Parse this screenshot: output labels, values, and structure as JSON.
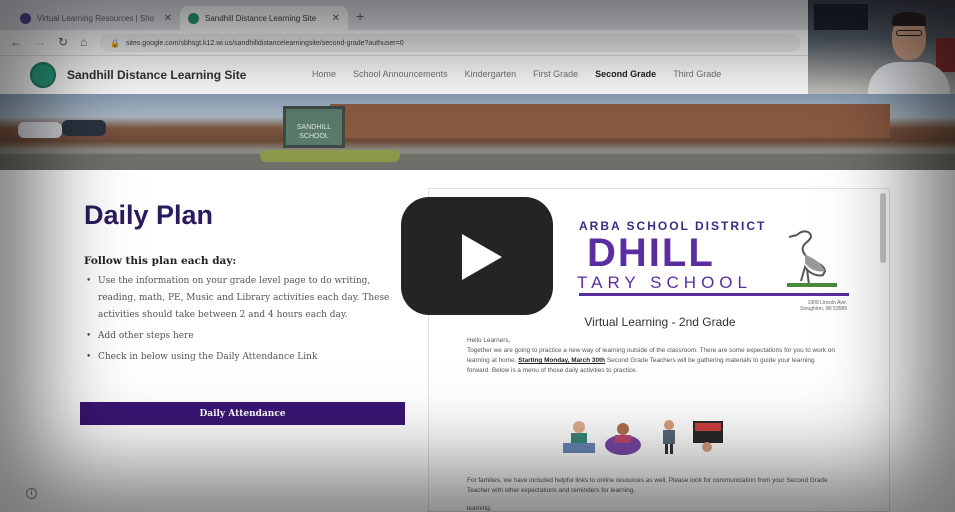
{
  "browser": {
    "tabs": [
      {
        "title": "Virtual Learning Resources | Sho",
        "favicon_color": "#5a4a9a"
      },
      {
        "title": "Sandhill Distance Learning Site",
        "favicon_color": "#2a9d80"
      }
    ],
    "url": "sites.google.com/sbhsgt.k12.wi.us/sandhilldistancelearningsite/second-grade?authuser=0"
  },
  "site": {
    "title": "Sandhill Distance Learning Site",
    "nav": [
      "Home",
      "School Announcements",
      "Kindergarten",
      "First Grade",
      "Second Grade",
      "Third Grade"
    ],
    "active_nav": "Second Grade"
  },
  "hero": {
    "sign_line1": "SANDHILL",
    "sign_line2": "SCHOOL"
  },
  "main": {
    "heading": "Daily Plan",
    "subheading": "Follow this plan each day:",
    "plan_items": [
      "Use the information on your grade level page to do writing, reading, math, PE, Music and Library activities each day.  These activities should take between 2 and 4 hours each day.",
      "Add other steps here",
      "Check in below using the Daily Attendance Link"
    ],
    "attendance_button": "Daily Attendance"
  },
  "doc": {
    "district": "ARBA SCHOOL DISTRICT",
    "school": "DHILL",
    "school_type": "TARY SCHOOL",
    "address_line1": "1908 Lincoln Ave.",
    "address_line2": "Stoughton, WI 53589",
    "title": "Virtual Learning - 2nd Grade",
    "greeting": "Hello Learners,",
    "para1_a": "Together we are going to practice a new way of learning outside of the classroom. There are some expectations for you to work on learning at home.",
    "para1_hl": "Starting Monday, March 30th",
    "para1_b": "Second Grade Teachers will be gathering materials to guide your learning forward. Below is a menu of those daily activities to practice.",
    "para2": "For families, we have included helpful links to online resources as well. Please look for communication from your Second Grade Teacher with other expectations and reminders for learning.",
    "foot": "learning."
  },
  "colors": {
    "heading": "#2a1b5e",
    "button": "#3a1673",
    "school_purple": "#5a2ea0"
  }
}
